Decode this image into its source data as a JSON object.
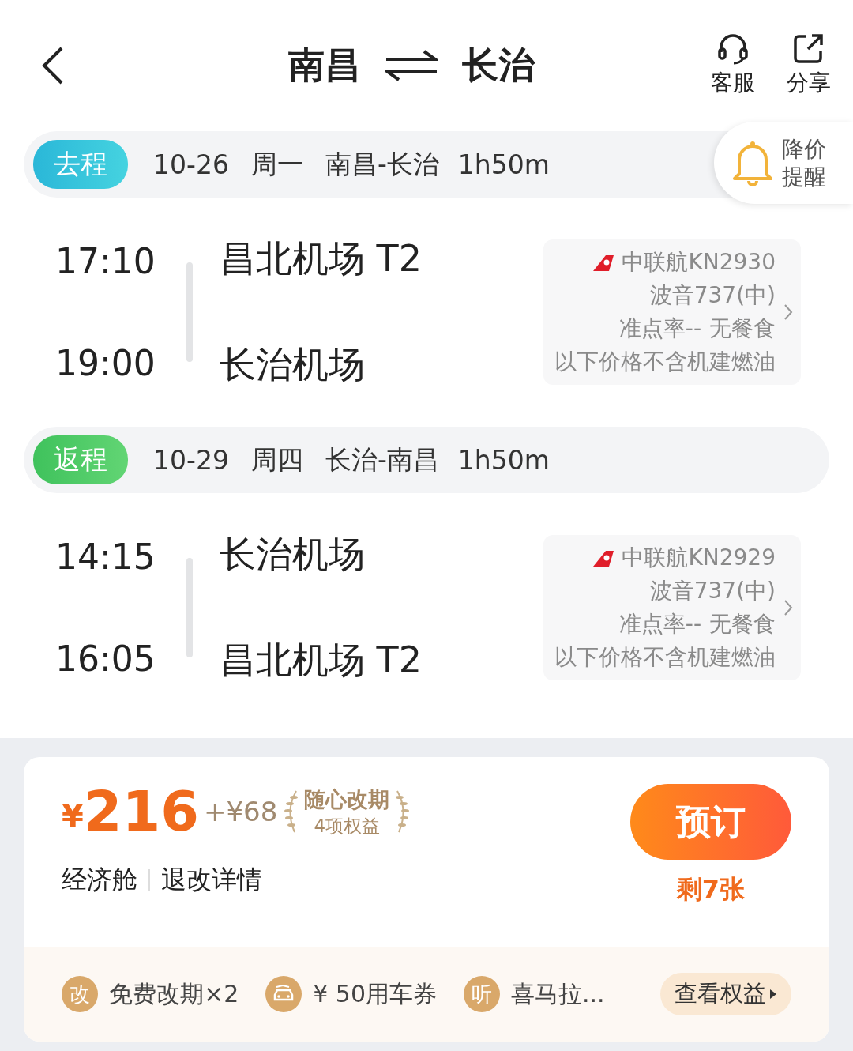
{
  "header": {
    "from": "南昌",
    "to": "长治",
    "actions": [
      {
        "kind": "service",
        "label": "客服"
      },
      {
        "kind": "share",
        "label": "分享"
      }
    ]
  },
  "price_alert": {
    "line1": "降价",
    "line2": "提醒"
  },
  "segments": [
    {
      "kind": "outbound",
      "label": "去程",
      "date": "10-26",
      "weekday": "周一",
      "route": "南昌-长治",
      "duration": "1h50m",
      "depart_time": "17:10",
      "depart_airport": "昌北机场 T2",
      "arrive_time": "19:00",
      "arrive_airport": "长治机场",
      "flight": "中联航KN2930",
      "aircraft": "波音737(中)",
      "ontime": "准点率--",
      "meal": "无餐食",
      "note": "以下价格不含机建燃油"
    },
    {
      "kind": "return",
      "label": "返程",
      "date": "10-29",
      "weekday": "周四",
      "route": "长治-南昌",
      "duration": "1h50m",
      "depart_time": "14:15",
      "depart_airport": "长治机场",
      "arrive_time": "16:05",
      "arrive_airport": "昌北机场 T2",
      "flight": "中联航KN2929",
      "aircraft": "波音737(中)",
      "ontime": "准点率--",
      "meal": "无餐食",
      "note": "以下价格不含机建燃油"
    }
  ],
  "offer": {
    "currency": "¥",
    "price": "216",
    "extra": "+¥68",
    "badge_title": "随心改期",
    "badge_sub": "4项权益",
    "cabin": "经济舱",
    "rules": "退改详情",
    "book": "预订",
    "remaining": "剩7张",
    "perks": [
      {
        "kind": "text",
        "icon": "改",
        "label": "免费改期×2"
      },
      {
        "kind": "car",
        "label": "¥ 50用车券"
      },
      {
        "kind": "text",
        "icon": "听",
        "label": "喜马拉..."
      }
    ],
    "more": "查看权益"
  }
}
